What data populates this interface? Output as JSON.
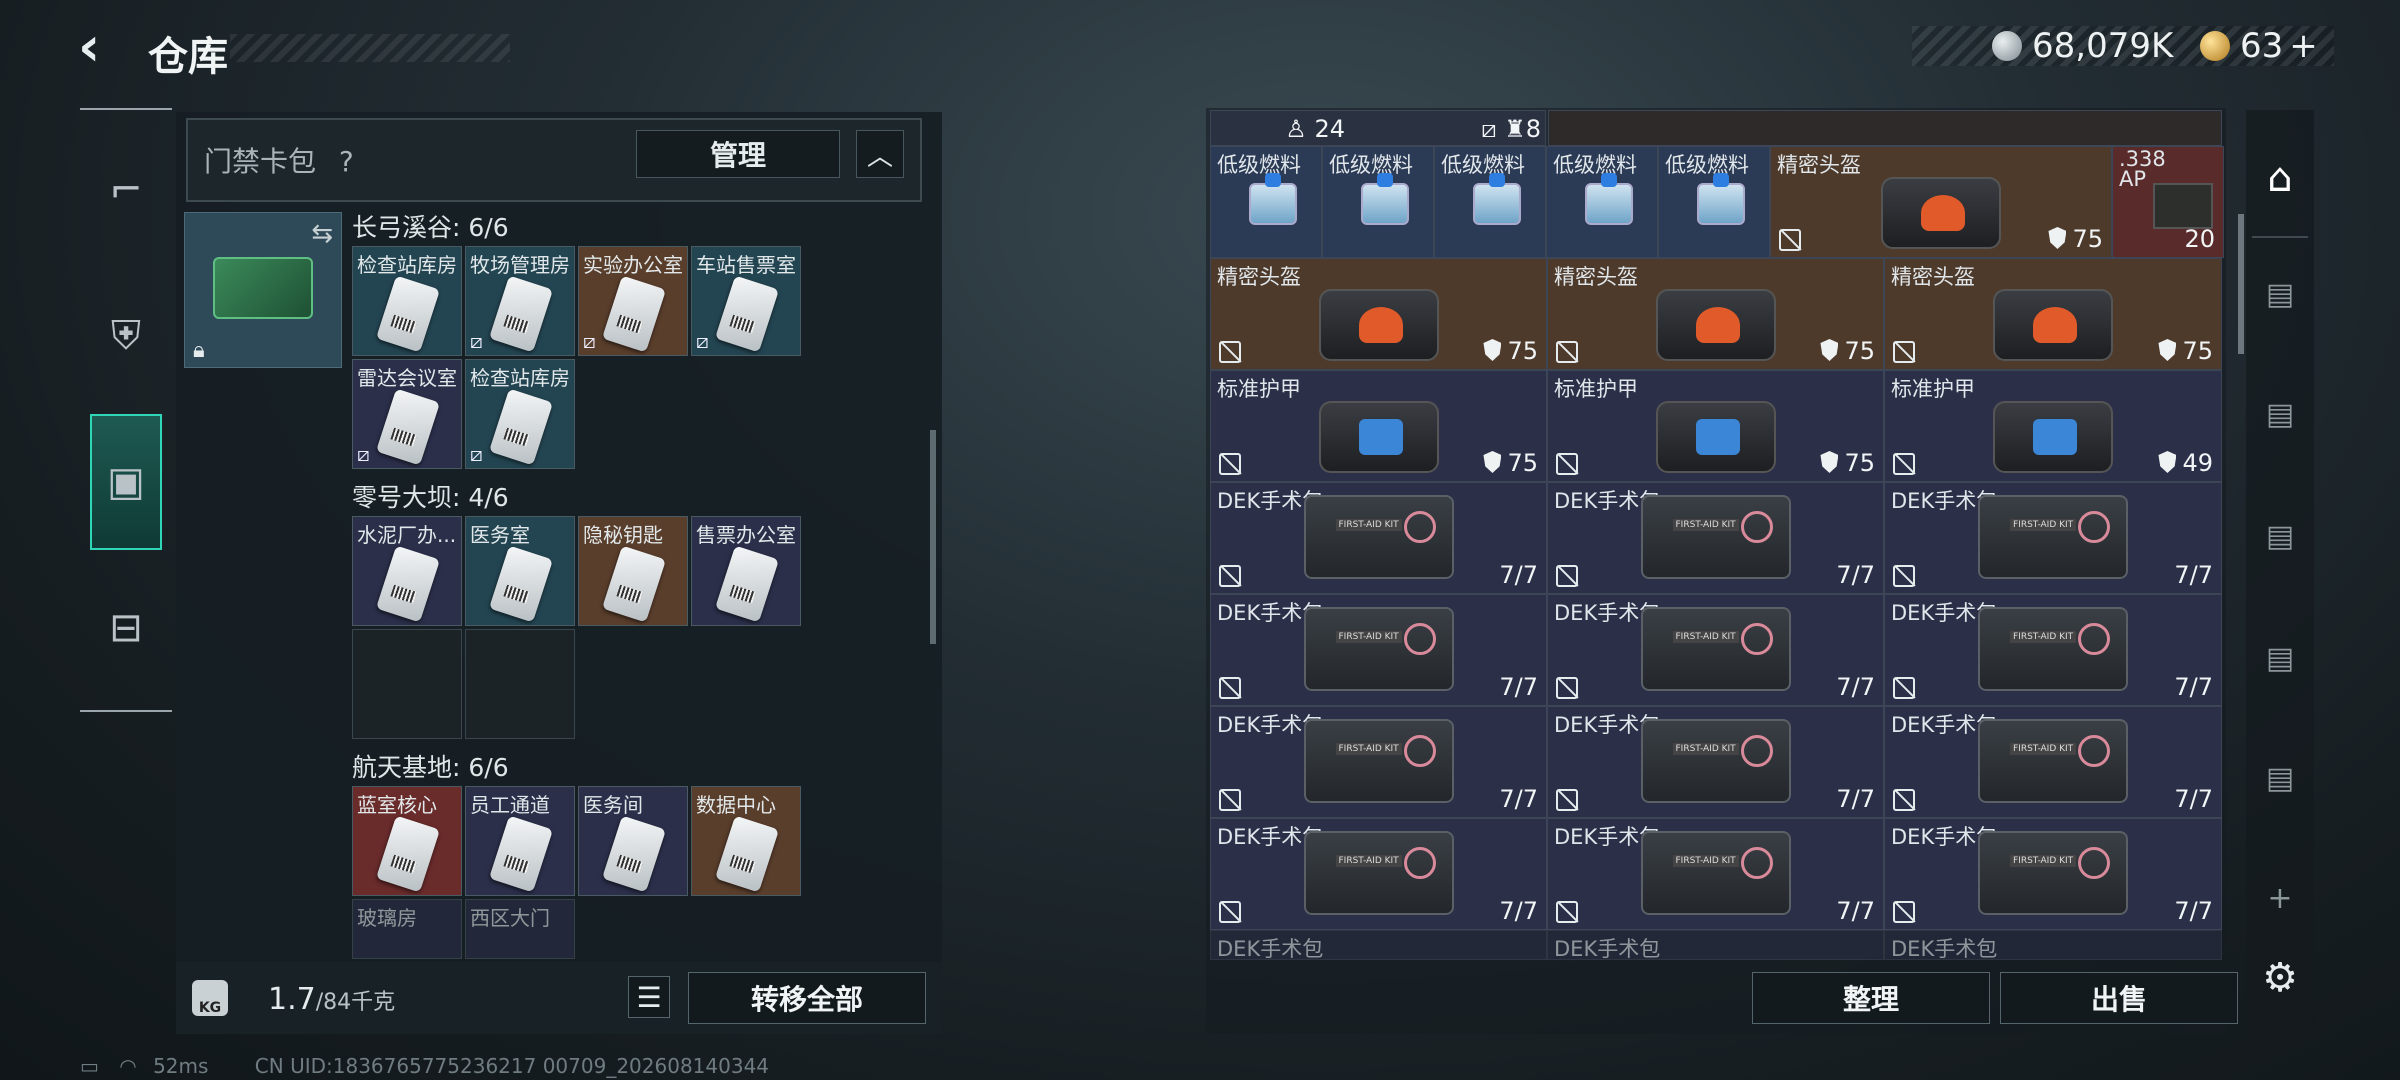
{
  "header": {
    "title": "仓库",
    "back_icon": "chevron-left-icon"
  },
  "currency": {
    "coins": "68,079K",
    "tickets": "63",
    "plus": "+"
  },
  "nav": [
    "weapon-icon",
    "backpack-icon",
    "keycard-case-icon",
    "briefcase-icon"
  ],
  "left_panel": {
    "title": "门禁卡包",
    "help": "?",
    "manage_label": "管理",
    "collapse": "^",
    "swap": "⇆",
    "sections": [
      {
        "title": "长弓溪谷: 6/6",
        "cards": [
          "检查站库房",
          "牧场管理房",
          "实验办公室",
          "车站售票室",
          "雷达会议室",
          "检查站库房"
        ]
      },
      {
        "title": "零号大坝: 4/6",
        "cards": [
          "水泥厂办...",
          "医务室",
          "隐秘钥匙",
          "售票办公室"
        ]
      },
      {
        "title": "航天基地: 6/6",
        "cards": [
          "蓝室核心",
          "员工通道",
          "医务间",
          "数据中心",
          "玻璃房",
          "西区大门"
        ]
      }
    ],
    "weight_icon": "KG",
    "weight_value": "1.7",
    "weight_max": "/84千克",
    "list_icon": "☰",
    "transfer_label": "转移全部"
  },
  "status_bar": {
    "ping": "52ms",
    "uid": "CN UID:1836765775236217 00709_202608140344"
  },
  "storage": {
    "top_row": {
      "count1": "24",
      "count2": "8"
    },
    "row1": [
      {
        "name": "低级燃料"
      },
      {
        "name": "低级燃料"
      },
      {
        "name": "低级燃料"
      },
      {
        "name": "低级燃料"
      },
      {
        "name": "低级燃料"
      },
      {
        "name": "精密头盔",
        "value": "75"
      },
      {
        "name": ".338 AP",
        "value": "20"
      }
    ],
    "row2": [
      {
        "name": "精密头盔",
        "value": "75"
      },
      {
        "name": "精密头盔",
        "value": "75"
      },
      {
        "name": "精密头盔",
        "value": "75"
      }
    ],
    "row3": [
      {
        "name": "标准护甲",
        "value": "75"
      },
      {
        "name": "标准护甲",
        "value": "75"
      },
      {
        "name": "标准护甲",
        "value": "49"
      }
    ],
    "medkit_name": "DEK手术包",
    "medkit_value": "7/7",
    "sort_label": "整理",
    "sell_label": "出售"
  },
  "right_rail": {
    "add": "+",
    "settings": "⚙"
  }
}
